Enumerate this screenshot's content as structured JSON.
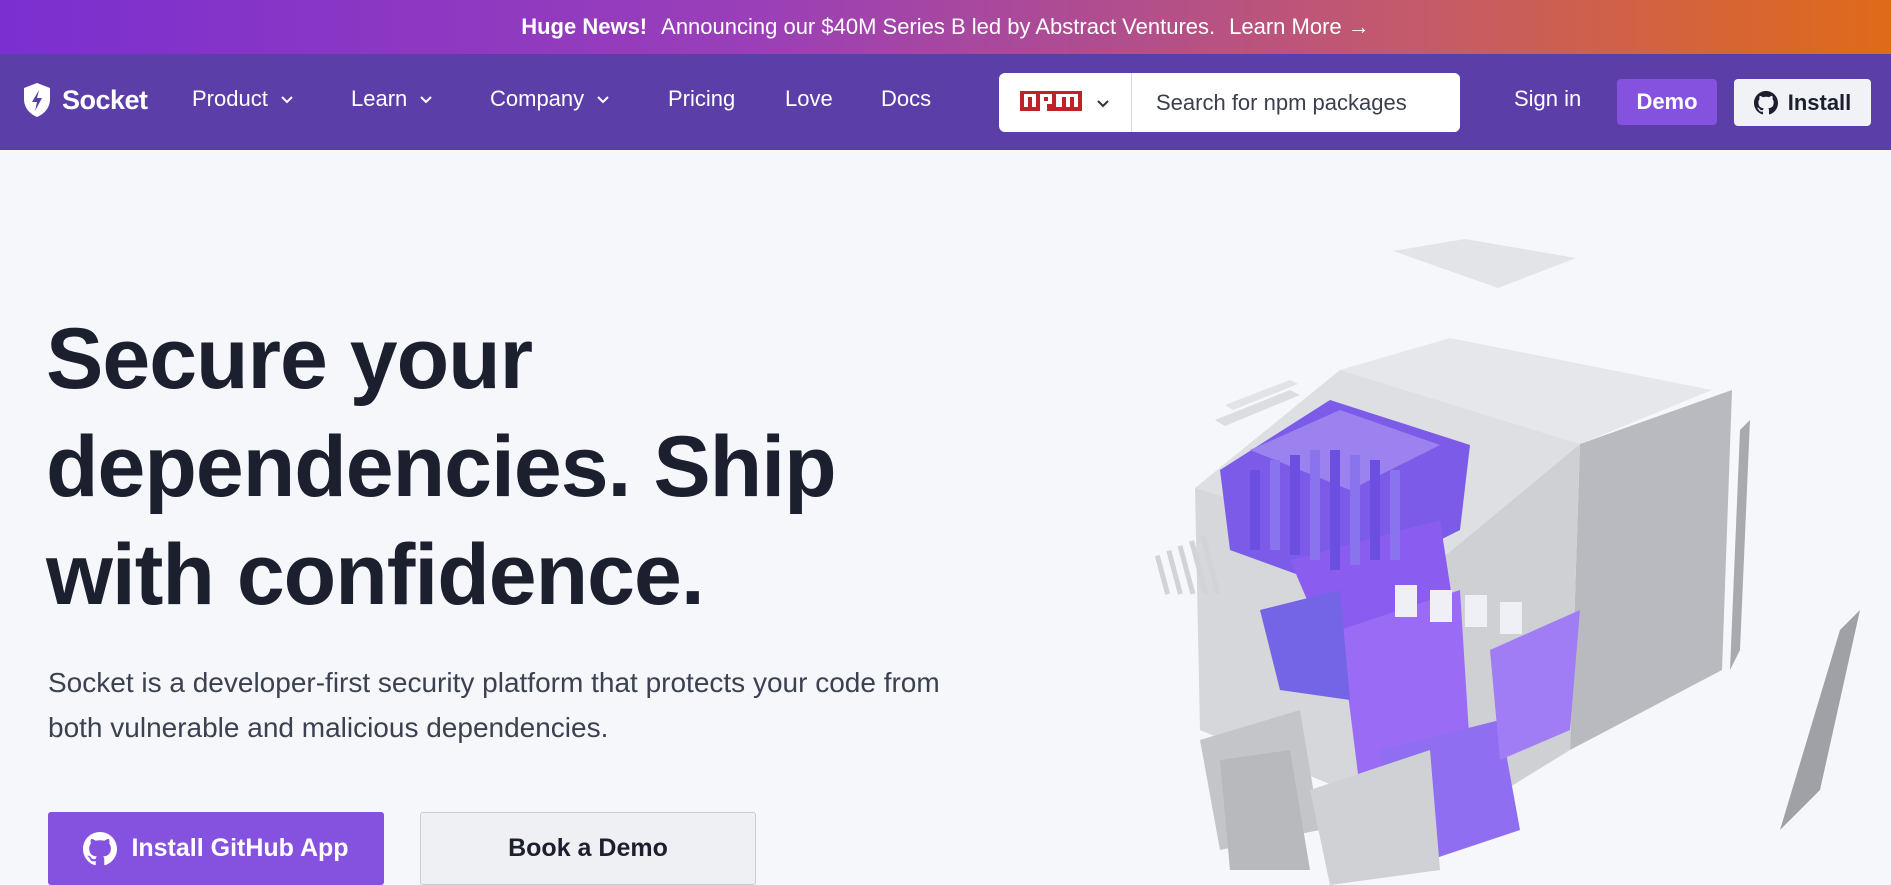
{
  "banner": {
    "headline": "Huge News!",
    "message": "Announcing our $40M Series B led by Abstract Ventures.",
    "link": "Learn More →"
  },
  "nav": {
    "brand": "Socket",
    "items": [
      "Product",
      "Learn",
      "Company",
      "Pricing",
      "Love",
      "Docs"
    ],
    "ecosystem": "npm",
    "search_placeholder": "Search for npm packages",
    "signin": "Sign in",
    "demo": "Demo",
    "install": "Install"
  },
  "hero": {
    "title": "Secure your dependencies. Ship with confidence.",
    "subtitle": "Socket is a developer-first security platform that protects your code from both vulnerable and malicious dependencies.",
    "primary_cta": "Install GitHub App",
    "secondary_cta": "Book a Demo",
    "illustration": "isometric-block-cube"
  },
  "colors": {
    "banner_start": "#7b2fd0",
    "banner_end": "#e06a18",
    "nav_bg": "#5b3ea8",
    "accent": "#8552e0",
    "page_bg": "#f5f7fb",
    "npm_red": "#c12127"
  }
}
